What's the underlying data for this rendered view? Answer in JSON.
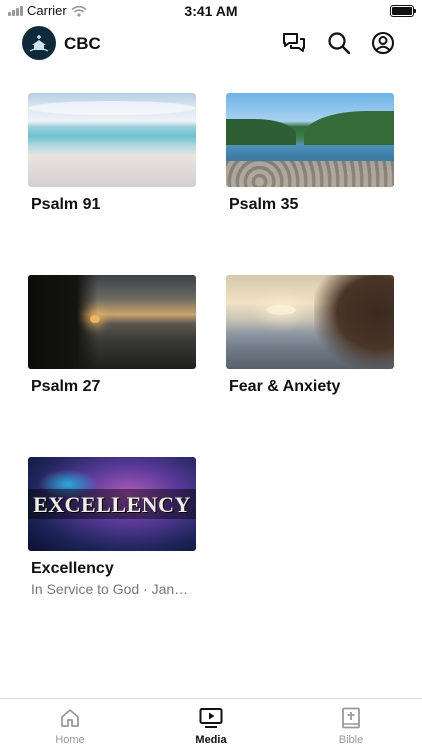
{
  "status_bar": {
    "carrier": "Carrier",
    "time": "3:41 AM"
  },
  "header": {
    "brand": "CBC"
  },
  "icons": {
    "chat": "chat-bubbles-icon",
    "search": "search-icon",
    "account": "account-icon",
    "wifi": "wifi-icon",
    "battery": "battery-icon"
  },
  "media": [
    {
      "title": "Psalm 91",
      "subtitle": ""
    },
    {
      "title": "Psalm 35",
      "subtitle": ""
    },
    {
      "title": "Psalm 27",
      "subtitle": ""
    },
    {
      "title": "Fear & Anxiety",
      "subtitle": ""
    },
    {
      "title": "Excellency",
      "subtitle": "In Service to God · Jan…",
      "thumb_text": "EXCELLENCY"
    }
  ],
  "tabs": [
    {
      "label": "Home",
      "icon": "home-icon",
      "active": false
    },
    {
      "label": "Media",
      "icon": "media-play-icon",
      "active": true
    },
    {
      "label": "Bible",
      "icon": "bible-icon",
      "active": false
    }
  ]
}
